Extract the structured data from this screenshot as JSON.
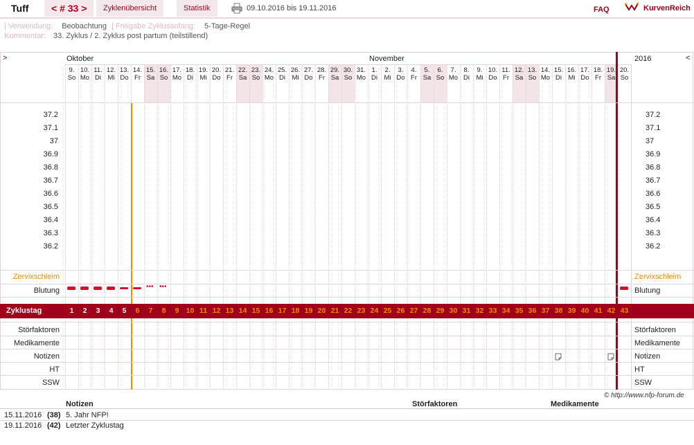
{
  "topbar": {
    "title": "Tuff",
    "cycle_nav": "< # 33 >",
    "tab_overview": "Zyklenübersicht",
    "tab_stats": "Statistik",
    "date_range": "09.10.2016 bis 19.11.2016",
    "faq": "FAQ",
    "brand": "KurvenReich"
  },
  "info": {
    "usage_label": "Verwendung:",
    "usage_value": "Beobachtung",
    "release_label": "Freigabe Zyklusanfang:",
    "release_value": "5-Tage-Regel",
    "comment_label": "Kommentar:",
    "comment_value": "33. Zyklus / 2. Zyklus post partum (teilstillend)"
  },
  "chart_header": {
    "nav_left": ">",
    "nav_right": "<",
    "month_oct": "Oktober",
    "month_nov": "November",
    "year": "2016"
  },
  "days": [
    {
      "d": "9.",
      "w": "So",
      "we": false
    },
    {
      "d": "10.",
      "w": "Mo",
      "we": false
    },
    {
      "d": "11.",
      "w": "Di",
      "we": false
    },
    {
      "d": "12.",
      "w": "Mi",
      "we": false
    },
    {
      "d": "13.",
      "w": "Do",
      "we": false
    },
    {
      "d": "14.",
      "w": "Fr",
      "we": false
    },
    {
      "d": "15.",
      "w": "Sa",
      "we": true
    },
    {
      "d": "16.",
      "w": "So",
      "we": true
    },
    {
      "d": "17.",
      "w": "Mo",
      "we": false
    },
    {
      "d": "18.",
      "w": "Di",
      "we": false
    },
    {
      "d": "19.",
      "w": "Mi",
      "we": false
    },
    {
      "d": "20.",
      "w": "Do",
      "we": false
    },
    {
      "d": "21.",
      "w": "Fr",
      "we": false
    },
    {
      "d": "22.",
      "w": "Sa",
      "we": true
    },
    {
      "d": "23.",
      "w": "So",
      "we": true
    },
    {
      "d": "24.",
      "w": "Mo",
      "we": false
    },
    {
      "d": "25.",
      "w": "Di",
      "we": false
    },
    {
      "d": "26.",
      "w": "Mi",
      "we": false
    },
    {
      "d": "27.",
      "w": "Do",
      "we": false
    },
    {
      "d": "28.",
      "w": "Fr",
      "we": false
    },
    {
      "d": "29.",
      "w": "Sa",
      "we": true
    },
    {
      "d": "30.",
      "w": "So",
      "we": true
    },
    {
      "d": "31.",
      "w": "Mo",
      "we": false
    },
    {
      "d": "1.",
      "w": "Di",
      "we": false
    },
    {
      "d": "2.",
      "w": "Mi",
      "we": false
    },
    {
      "d": "3.",
      "w": "Do",
      "we": false
    },
    {
      "d": "4.",
      "w": "Fr",
      "we": false
    },
    {
      "d": "5.",
      "w": "Sa",
      "we": true
    },
    {
      "d": "6.",
      "w": "So",
      "we": true
    },
    {
      "d": "7.",
      "w": "Mo",
      "we": false
    },
    {
      "d": "8.",
      "w": "Di",
      "we": false
    },
    {
      "d": "9.",
      "w": "Mi",
      "we": false
    },
    {
      "d": "10.",
      "w": "Do",
      "we": false
    },
    {
      "d": "11.",
      "w": "Fr",
      "we": false
    },
    {
      "d": "12.",
      "w": "Sa",
      "we": true
    },
    {
      "d": "13.",
      "w": "So",
      "we": true
    },
    {
      "d": "14.",
      "w": "Mo",
      "we": false
    },
    {
      "d": "15.",
      "w": "Di",
      "we": false
    },
    {
      "d": "16.",
      "w": "Mi",
      "we": false
    },
    {
      "d": "17.",
      "w": "Do",
      "we": false
    },
    {
      "d": "18.",
      "w": "Fr",
      "we": false
    },
    {
      "d": "19.",
      "w": "Sa",
      "we": true
    },
    {
      "d": "20.",
      "w": "So",
      "we": false
    }
  ],
  "temperatures": [
    "37.2",
    "37.1",
    "37",
    "36.9",
    "36.8",
    "36.7",
    "36.6",
    "36.5",
    "36.4",
    "36.3",
    "36.2"
  ],
  "row_labels": {
    "cervix": "Zervixschleim",
    "bleeding": "Blutung",
    "cycle_day": "Zyklustag",
    "disturb": "Störfaktoren",
    "medication": "Medikamente",
    "notes": "Notizen",
    "ht": "HT",
    "ssw": "SSW"
  },
  "cycle_days": [
    "1",
    "2",
    "3",
    "4",
    "5",
    "6",
    "7",
    "8",
    "9",
    "10",
    "11",
    "12",
    "13",
    "14",
    "15",
    "16",
    "17",
    "18",
    "19",
    "20",
    "21",
    "22",
    "23",
    "24",
    "25",
    "26",
    "27",
    "28",
    "29",
    "30",
    "31",
    "32",
    "33",
    "34",
    "35",
    "36",
    "37",
    "38",
    "39",
    "40",
    "41",
    "42",
    "43"
  ],
  "bleeding": [
    "heavy",
    "heavy",
    "heavy",
    "heavy",
    "medium",
    "medium",
    "light",
    "light"
  ],
  "colors": {
    "accent": "#a0001a",
    "orange": "#f28c00",
    "weekend": "#f3e4e8"
  },
  "copyright": "© http://www.nfp-forum.de",
  "footer": {
    "headers": {
      "notes": "Notizen",
      "disturb": "Störfaktoren",
      "medication": "Medikamente"
    },
    "rows": [
      {
        "date": "15.11.2016",
        "day": "(38)",
        "note": "5. Jahr NFP!"
      },
      {
        "date": "19.11.2016",
        "day": "(42)",
        "note": "Letzter Zyklustag"
      }
    ]
  }
}
